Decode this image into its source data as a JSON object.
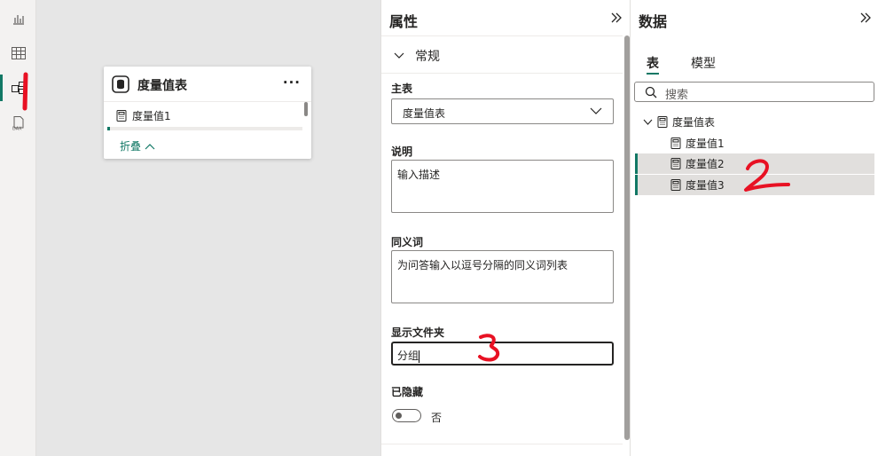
{
  "rail": {
    "items": [
      {
        "icon": "report-view-icon"
      },
      {
        "icon": "table-view-icon"
      },
      {
        "icon": "model-view-icon",
        "active": true
      },
      {
        "icon": "dax-query-view-icon"
      }
    ]
  },
  "canvas": {
    "card": {
      "title": "度量值表",
      "more": "···",
      "items": [
        "度量值1"
      ],
      "collapse_label": "折叠"
    }
  },
  "properties": {
    "title": "属性",
    "section": "常规",
    "main_table_label": "主表",
    "main_table_value": "度量值表",
    "description_label": "说明",
    "description_placeholder": "输入描述",
    "synonyms_label": "同义词",
    "synonyms_placeholder": "为问答输入以逗号分隔的同义词列表",
    "display_folder_label": "显示文件夹",
    "display_folder_value": "分组",
    "hidden_label": "已隐藏",
    "hidden_value": "否"
  },
  "data": {
    "title": "数据",
    "tabs": [
      "表",
      "模型"
    ],
    "search_placeholder": "搜索",
    "tree": {
      "table": "度量值表",
      "measures": [
        "度量值1",
        "度量值2",
        "度量值3"
      ]
    }
  },
  "annotations": [
    "1",
    "2",
    "3"
  ],
  "colors": {
    "accent": "#117865",
    "annotation": "#e81123"
  }
}
